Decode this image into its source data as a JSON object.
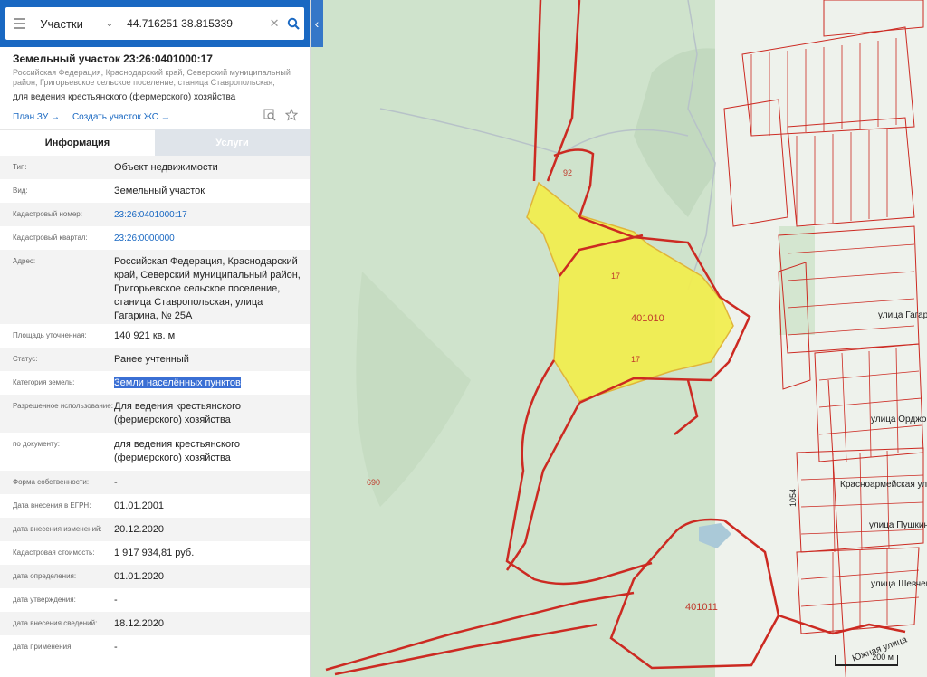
{
  "search": {
    "layer": "Участки",
    "query": "44.716251 38.815339"
  },
  "object": {
    "title": "Земельный участок 23:26:0401000:17",
    "address_short": "Российская Федерация, Краснодарский край, Северский муниципальный район, Григорьевское сельское поселение, станица Ставропольская, улица Гага...",
    "purpose": "для ведения крестьянского (фермерского) хозяйства",
    "link_plan": "План ЗУ →",
    "link_create": "Создать участок ЖС →"
  },
  "tabs": {
    "info": "Информация",
    "services": "Услуги"
  },
  "rows": [
    {
      "label": "Тип:",
      "value": "Объект недвижимости"
    },
    {
      "label": "Вид:",
      "value": "Земельный участок"
    },
    {
      "label": "Кадастровый номер:",
      "value": "23:26:0401000:17"
    },
    {
      "label": "Кадастровый квартал:",
      "value": "23:26:0000000"
    },
    {
      "label": "Адрес:",
      "value": "Российская Федерация, Краснодарский край, Северский муниципальный район, Григорьевское сельское поселение, станица Ставропольская, улица Гагарина, № 25А"
    },
    {
      "label": "Площадь уточненная:",
      "value": "140 921 кв. м"
    },
    {
      "label": "Статус:",
      "value": "Ранее учтенный"
    },
    {
      "label": "Категория земель:",
      "value": "Земли населённых пунктов"
    },
    {
      "label": "Разрешенное использование:",
      "value": "Для ведения крестьянского (фермерского) хозяйства"
    },
    {
      "label": "по документу:",
      "value": "для ведения крестьянского (фермерского) хозяйства"
    },
    {
      "label": "Форма собственности:",
      "value": "-"
    },
    {
      "label": "Дата внесения в ЕГРН:",
      "value": "01.01.2001"
    },
    {
      "label": "дата внесения изменений:",
      "value": "20.12.2020"
    },
    {
      "label": "Кадастровая стоимость:",
      "value": "1 917 934,81 руб."
    },
    {
      "label": "дата определения:",
      "value": "01.01.2020"
    },
    {
      "label": "дата утверждения:",
      "value": "-"
    },
    {
      "label": "дата внесения сведений:",
      "value": "18.12.2020"
    },
    {
      "label": "дата применения:",
      "value": "-"
    }
  ],
  "map": {
    "labels": {
      "parcel_17_a": "17",
      "parcel_17_b": "17",
      "quarter_401010": "401010",
      "quarter_401011": "401011",
      "parcel_92": "92",
      "parcel_690": "690",
      "parcel_1054": "1054"
    },
    "streets": [
      "улица Гагарина",
      "улица Орджоникидзе",
      "Красноармейская улица",
      "улица Пушкина",
      "улица Шевченко",
      "Южная улица"
    ],
    "scale": "200 м",
    "colors": {
      "parcel_fill": "#f2ee4c",
      "boundary": "#cc2a22",
      "forest": "#cfe3cc"
    }
  }
}
